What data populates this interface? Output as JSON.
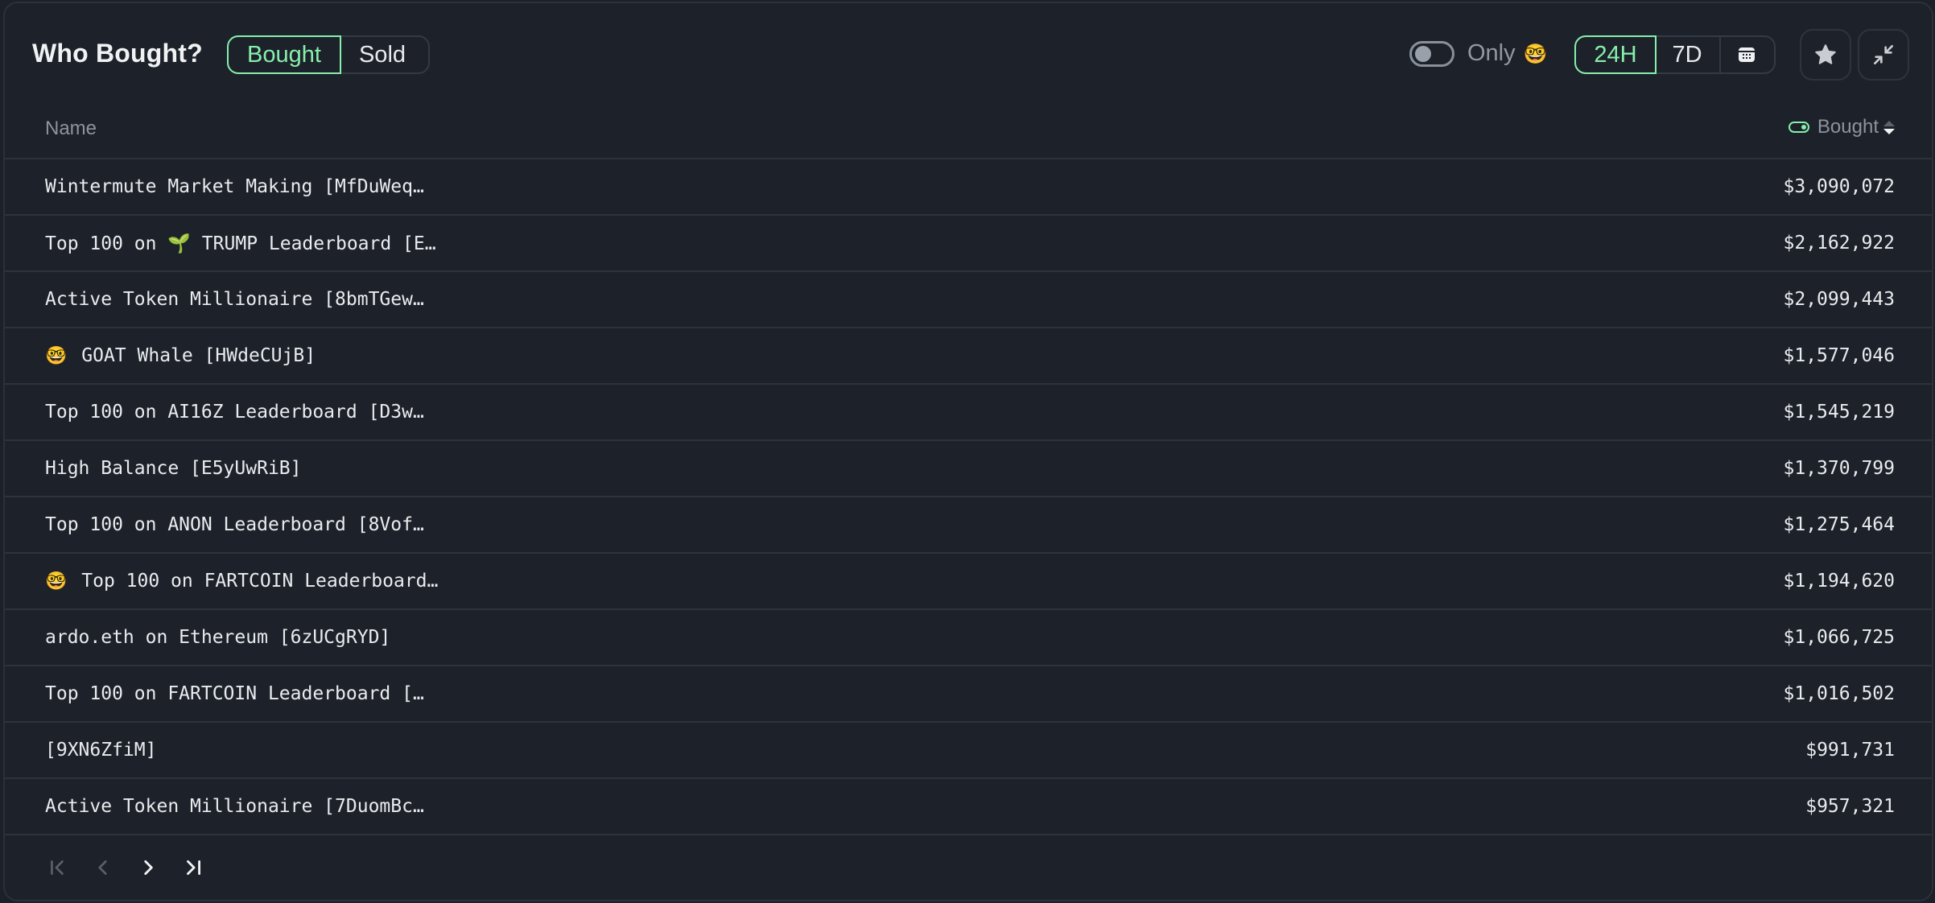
{
  "header": {
    "title": "Who Bought?",
    "side_tabs": [
      {
        "label": "Bought",
        "active": true
      },
      {
        "label": "Sold",
        "active": false
      }
    ],
    "only_toggle": {
      "label": "Only",
      "emoji": "🤓",
      "on": false
    },
    "time_tabs": [
      {
        "label": "24H",
        "active": true
      },
      {
        "label": "7D",
        "active": false
      }
    ],
    "calendar_icon": "calendar-icon",
    "star_icon": "star-icon",
    "collapse_icon": "collapse-icon"
  },
  "table": {
    "columns": {
      "name": "Name",
      "value": "Bought"
    },
    "sort": "descending",
    "rows": [
      {
        "lead": "",
        "name": "Wintermute Market Making [MfDuWeq…",
        "value": "$3,090,072"
      },
      {
        "lead": "",
        "name": "Top 100 on 🌱 TRUMP Leaderboard [E…",
        "value": "$2,162,922"
      },
      {
        "lead": "",
        "name": "Active Token Millionaire [8bmTGew…",
        "value": "$2,099,443"
      },
      {
        "lead": "🤓",
        "name": "GOAT Whale [HWdeCUjB]",
        "value": "$1,577,046"
      },
      {
        "lead": "",
        "name": "Top 100 on AI16Z Leaderboard [D3w…",
        "value": "$1,545,219"
      },
      {
        "lead": "",
        "name": "High Balance [E5yUwRiB]",
        "value": "$1,370,799"
      },
      {
        "lead": "",
        "name": "Top 100 on ANON Leaderboard [8Vof…",
        "value": "$1,275,464"
      },
      {
        "lead": "🤓",
        "name": "Top 100 on FARTCOIN Leaderboard…",
        "value": "$1,194,620"
      },
      {
        "lead": "",
        "name": "ardo.eth on Ethereum [6zUCgRYD]",
        "value": "$1,066,725"
      },
      {
        "lead": "",
        "name": "Top 100 on FARTCOIN Leaderboard […",
        "value": "$1,016,502"
      },
      {
        "lead": "",
        "name": "[9XN6ZfiM]",
        "value": "$991,731"
      },
      {
        "lead": "",
        "name": "Active Token Millionaire [7DuomBc…",
        "value": "$957,321"
      }
    ]
  },
  "pagination": {
    "first": {
      "icon": "first-page-icon",
      "enabled": false
    },
    "prev": {
      "icon": "prev-page-icon",
      "enabled": false
    },
    "next": {
      "icon": "next-page-icon",
      "enabled": true
    },
    "last": {
      "icon": "last-page-icon",
      "enabled": true
    }
  },
  "colors": {
    "accent": "#86efac",
    "background": "#1d222a",
    "border": "#2d333c",
    "text": "#e9ebee",
    "muted": "#8d939d"
  }
}
